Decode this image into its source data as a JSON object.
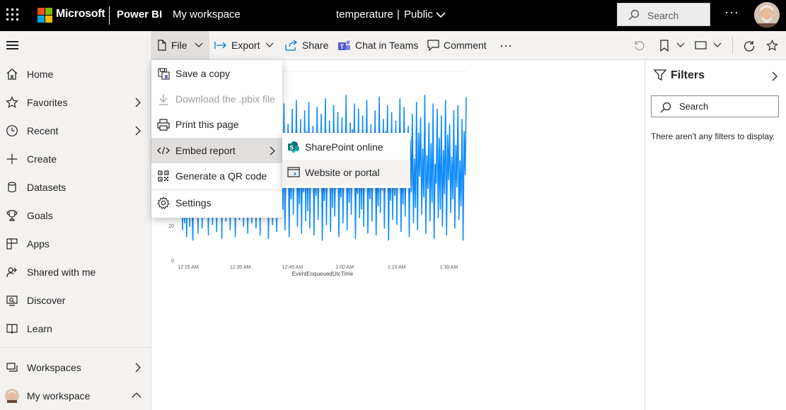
{
  "topbar": {
    "brand": "Microsoft",
    "product": "Power BI",
    "workspace": "My workspace",
    "report_title": "temperature",
    "title_separator": "|",
    "visibility": "Public",
    "search_placeholder": "Search",
    "more": "···"
  },
  "toolbar": {
    "file": "File",
    "export": "Export",
    "share": "Share",
    "chat_in_teams": "Chat in Teams",
    "comment": "Comment",
    "more": "···"
  },
  "nav": {
    "items": [
      {
        "label": "Home",
        "icon": "home-icon"
      },
      {
        "label": "Favorites",
        "icon": "star-icon"
      },
      {
        "label": "Recent",
        "icon": "clock-icon"
      },
      {
        "label": "Create",
        "icon": "plus-icon"
      },
      {
        "label": "Datasets",
        "icon": "database-icon"
      },
      {
        "label": "Goals",
        "icon": "trophy-icon"
      },
      {
        "label": "Apps",
        "icon": "apps-icon"
      },
      {
        "label": "Shared with me",
        "icon": "shared-icon"
      },
      {
        "label": "Discover",
        "icon": "discover-icon"
      },
      {
        "label": "Learn",
        "icon": "book-icon"
      }
    ],
    "workspaces": "Workspaces",
    "my_workspace": "My workspace"
  },
  "file_menu": {
    "items": [
      {
        "label": "Save a copy",
        "enabled": true
      },
      {
        "label": "Download the .pbix file",
        "enabled": false
      },
      {
        "label": "Print this page",
        "enabled": true
      },
      {
        "label": "Embed report",
        "enabled": true
      },
      {
        "label": "Generate a QR code",
        "enabled": true
      },
      {
        "label": "Settings",
        "enabled": true
      }
    ]
  },
  "embed_submenu": {
    "items": [
      {
        "label": "SharePoint online"
      },
      {
        "label": "Website or portal"
      }
    ]
  },
  "filters": {
    "title": "Filters",
    "search_placeholder": "Search",
    "empty_message": "There aren't any filters to display."
  },
  "chart_data": {
    "type": "line",
    "title": "",
    "xlabel": "EventEnqueuedUtcTime",
    "ylabel": "",
    "x_ticks": [
      "12:15 AM",
      "12:30 AM",
      "12:45 AM",
      "1:00 AM",
      "1:15 AM",
      "1:30 AM"
    ],
    "y_ticks": [
      "0",
      "20"
    ],
    "ylim": [
      0,
      100
    ],
    "series": [
      {
        "color": "#118dff",
        "values": [
          30,
          62,
          18,
          75,
          22,
          88,
          14,
          55,
          70,
          20,
          91,
          35,
          12,
          66,
          80,
          28,
          95,
          16,
          58,
          40,
          84,
          19,
          73,
          25,
          90,
          33,
          60,
          15,
          78,
          44,
          86,
          21,
          69,
          38,
          93,
          17,
          52,
          77,
          26,
          88,
          13,
          64,
          47,
          82,
          23,
          71,
          36,
          96,
          18,
          57,
          79,
          29,
          85,
          14,
          61,
          42,
          89,
          24,
          74,
          31,
          92,
          20,
          67,
          50,
          83,
          16,
          59,
          37,
          87,
          22,
          72,
          45,
          94,
          19,
          63,
          28,
          81,
          15,
          68,
          41,
          90,
          26,
          76,
          34,
          86,
          13,
          62,
          48,
          80,
          21,
          70,
          39,
          95,
          17,
          56,
          43,
          84,
          25,
          73,
          30,
          91,
          18,
          65,
          52,
          79,
          14,
          60,
          36,
          88,
          27,
          71,
          46,
          93,
          20,
          58,
          33,
          82,
          16,
          69,
          40,
          87,
          23,
          75,
          29,
          92,
          19,
          66,
          51,
          78,
          15,
          63,
          38,
          89,
          24,
          72,
          44,
          85,
          12,
          57,
          35,
          94,
          21,
          68,
          47,
          81,
          17,
          74,
          31,
          90,
          26,
          61,
          42,
          86,
          14,
          59,
          37,
          83,
          22,
          70,
          49,
          96,
          18,
          64,
          34,
          80,
          27,
          76,
          45,
          91,
          13,
          55,
          39,
          88,
          25,
          73,
          30,
          84,
          20,
          67,
          50,
          93,
          16,
          62,
          36,
          79,
          23,
          71,
          43,
          87,
          15,
          58,
          32,
          95,
          28,
          69,
          41,
          82,
          19,
          75,
          48,
          90,
          12,
          60,
          35,
          86,
          24,
          66,
          38,
          81,
          21,
          72,
          46,
          94,
          17,
          57,
          33,
          89,
          26,
          63,
          44,
          78,
          14,
          70,
          40,
          85,
          22,
          59,
          31,
          92,
          18,
          74,
          49,
          83,
          27,
          65,
          37,
          96,
          16,
          61,
          42,
          80,
          23,
          68,
          34,
          91,
          13,
          56,
          45,
          88,
          25,
          71,
          30,
          84,
          20,
          64,
          39,
          93,
          15,
          73,
          47,
          79,
          28,
          60,
          36,
          87,
          19,
          67,
          43,
          90,
          24,
          58,
          32,
          82,
          12,
          75,
          50,
          95
        ]
      }
    ]
  },
  "colors": {
    "accent": "#118dff",
    "topbar": "#000000"
  }
}
